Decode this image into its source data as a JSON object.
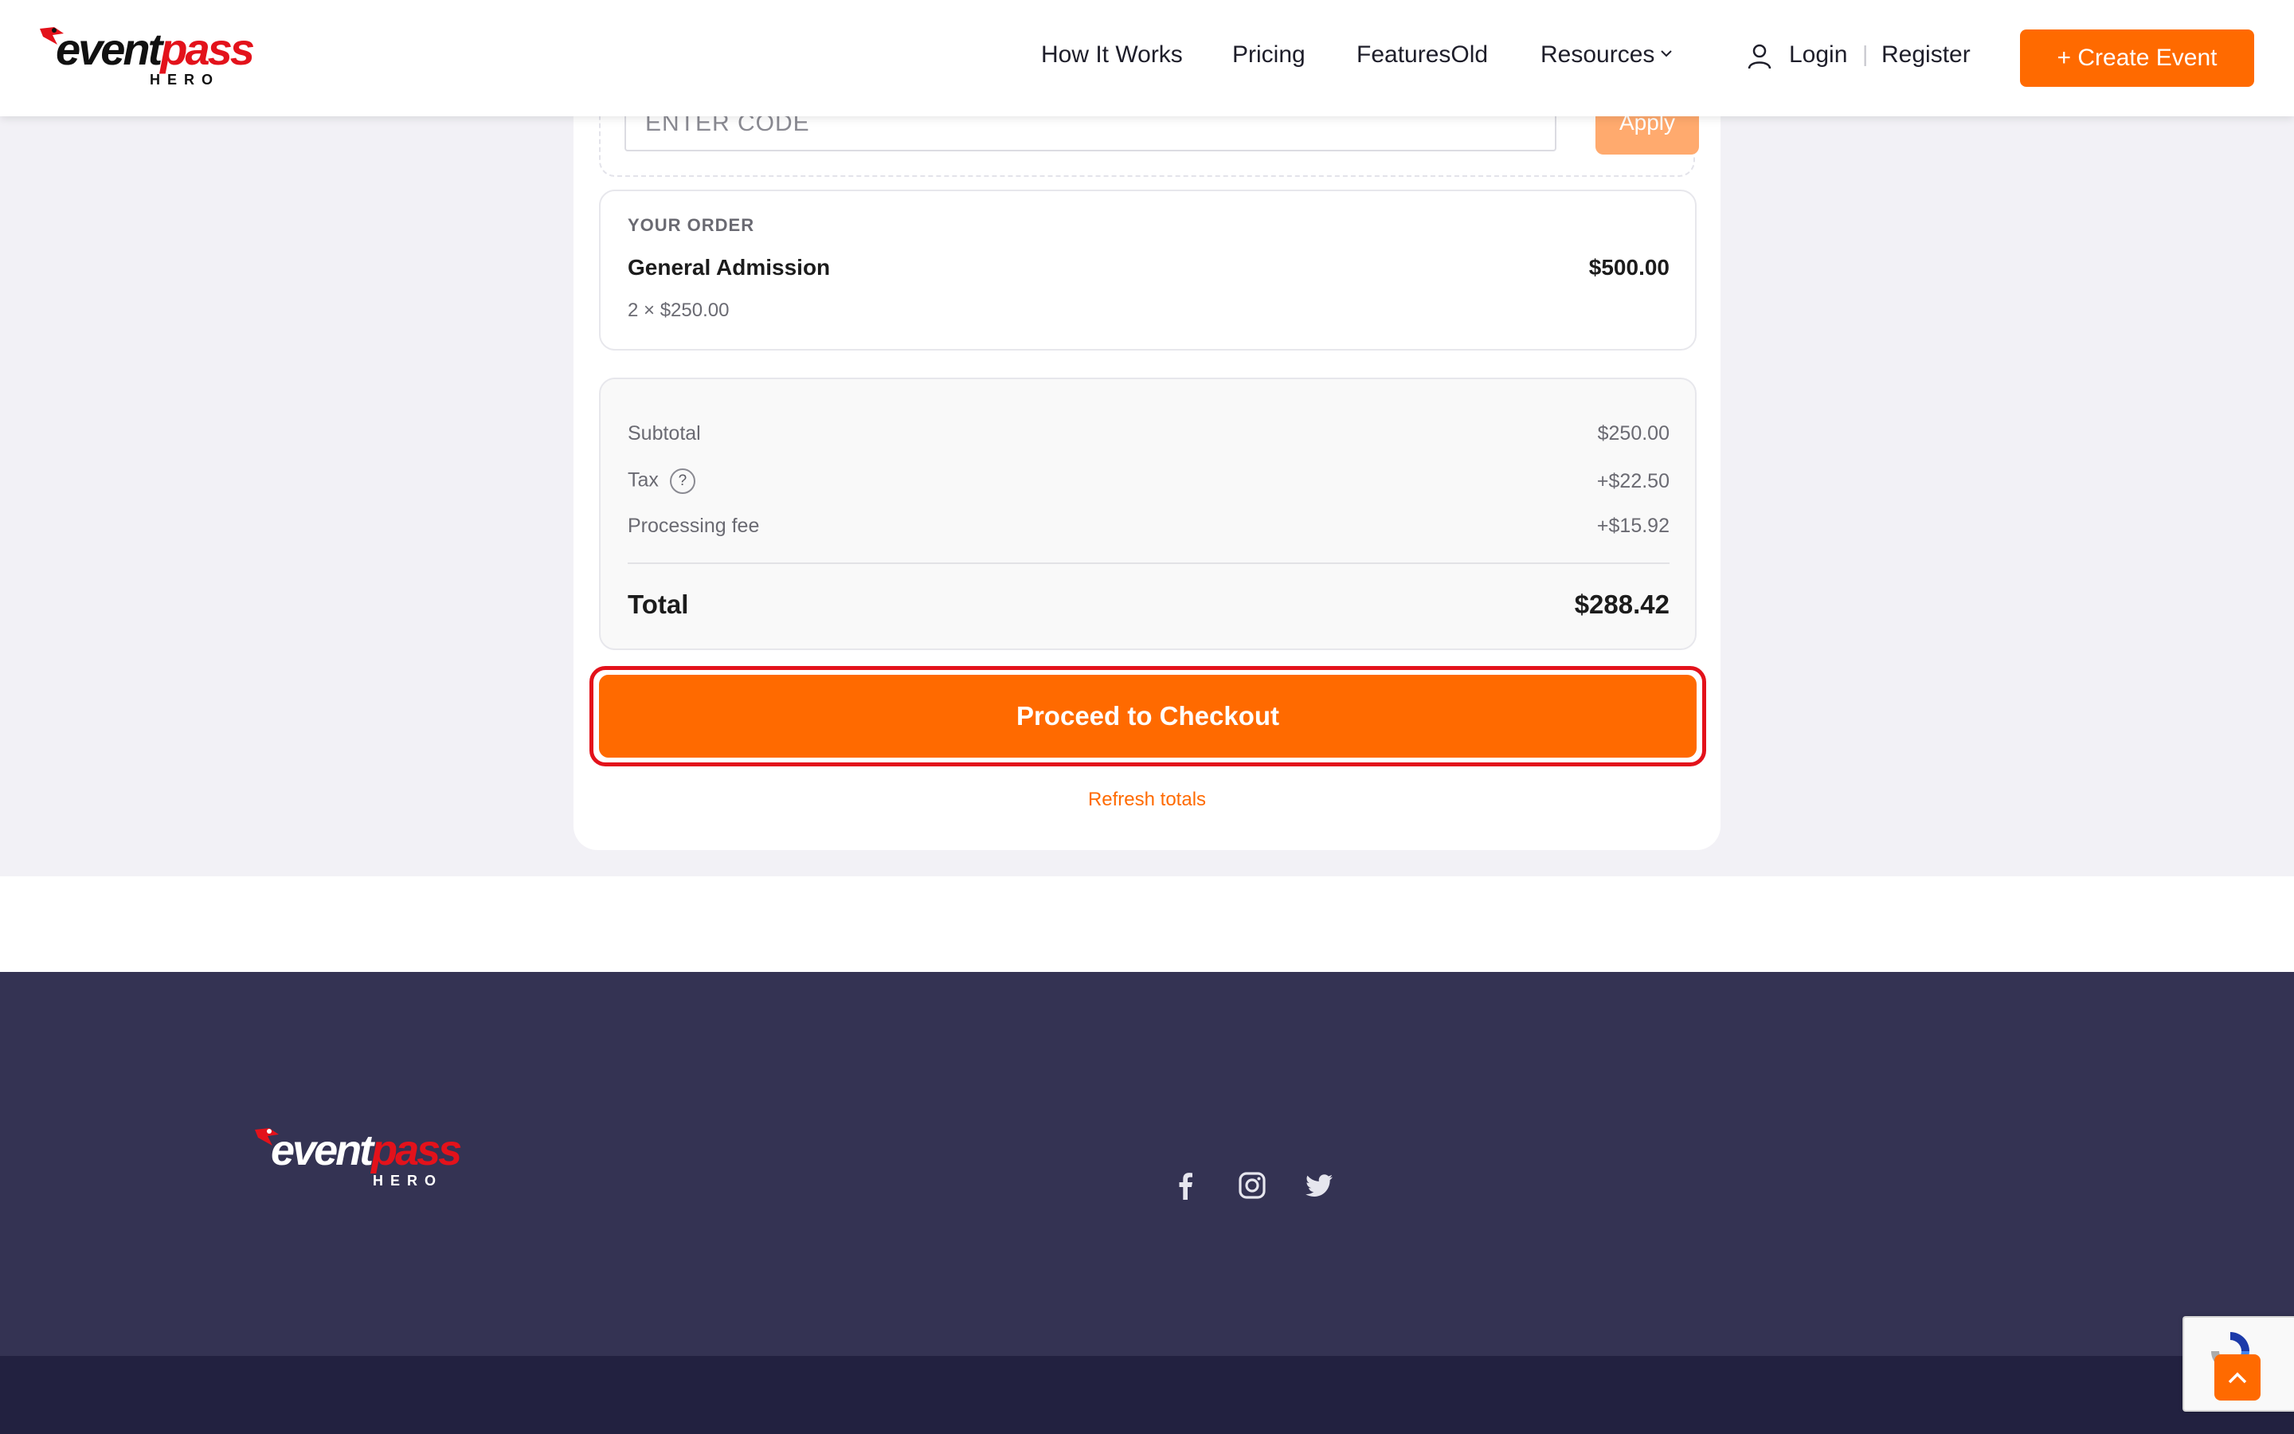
{
  "header": {
    "logo_word_1": "event",
    "logo_word_2": "pass",
    "logo_sub": "HERO",
    "nav": {
      "how_it_works": "How It Works",
      "pricing": "Pricing",
      "features": "FeaturesOld",
      "resources": "Resources",
      "login": "Login",
      "separator": "|",
      "register": "Register"
    },
    "create_event": "+ Create Event"
  },
  "coupon": {
    "placeholder": "ENTER CODE",
    "apply_label": "Apply"
  },
  "order": {
    "label": "YOUR ORDER",
    "item_name": "General Admission",
    "item_price": "$500.00",
    "item_qty": "2 × $250.00"
  },
  "totals": {
    "subtotal_label": "Subtotal",
    "subtotal_value": "$250.00",
    "tax_label": "Tax",
    "tax_help": "?",
    "tax_value": "+$22.50",
    "fee_label": "Processing fee",
    "fee_value": "+$15.92",
    "total_label": "Total",
    "total_value": "$288.42"
  },
  "checkout": {
    "button_label": "Proceed to Checkout",
    "refresh_label": "Refresh totals"
  },
  "footer": {
    "logo_word_1": "event",
    "logo_word_2": "pass",
    "logo_sub": "HERO",
    "social_icons": [
      "facebook-icon",
      "instagram-icon",
      "twitter-icon"
    ]
  },
  "colors": {
    "accent": "#ff6a00",
    "brand_red": "#e3121b",
    "footer_bg": "#343353",
    "footer_bottom_bg": "#222140"
  }
}
